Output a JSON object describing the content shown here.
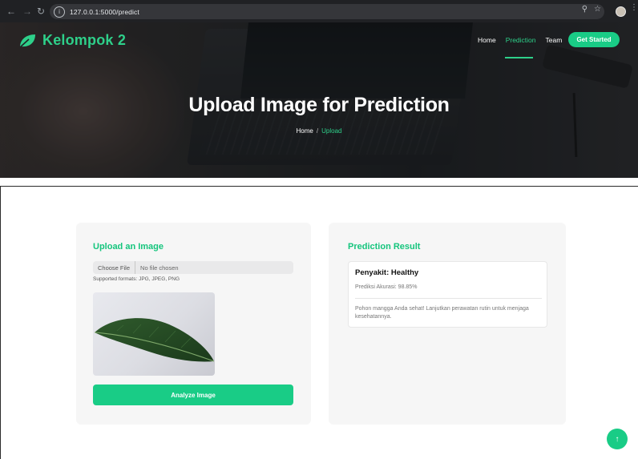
{
  "browser": {
    "url": "127.0.0.1:5000/predict",
    "back_icon": "arrow-left-icon",
    "forward_icon": "arrow-right-icon",
    "reload_icon": "reload-icon",
    "site_info_icon": "info-icon",
    "zoom_icon": "zoom-icon",
    "bookmark_icon": "star-icon"
  },
  "header": {
    "brand": "Kelompok 2",
    "brand_color": "#2ed08a",
    "nav": {
      "home": "Home",
      "prediction": "Prediction",
      "team": "Team"
    },
    "cta": "Get Started",
    "accent": "#19cc86"
  },
  "hero": {
    "title": "Upload Image for Prediction",
    "breadcrumb": {
      "home": "Home",
      "separator": "/",
      "current": "Upload"
    }
  },
  "upload": {
    "title": "Upload an Image",
    "choose_label": "Choose File",
    "file_status": "No file chosen",
    "formats": "Supported formats: JPG, JPEG, PNG",
    "analyze_label": "Analyze Image"
  },
  "result": {
    "title": "Prediction Result",
    "disease": "Penyakit: Healthy",
    "accuracy": "Prediksi Akurasi: 98.85%",
    "advice": "Pohon mangga Anda sehat! Lanjutkan perawatan rutin untuk menjaga kesehatannya."
  },
  "back_to_top_icon": "arrow-up-icon"
}
